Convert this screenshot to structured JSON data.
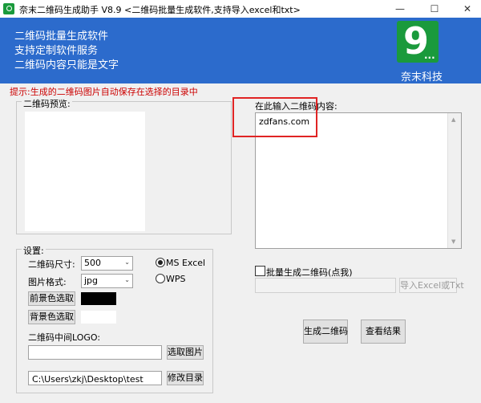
{
  "window": {
    "title": "奈末二维码生成助手 V8.9    <二维码批量生成软件,支持导入excel和txt>",
    "minimize": "—",
    "maximize": "☐",
    "close": "✕"
  },
  "banner": {
    "lines": [
      "二维码批量生成软件",
      "支持定制软件服务",
      "二维码内容只能是文字"
    ],
    "logo_text": "9",
    "logo_dots": "...",
    "company": "奈末科技",
    "bg_color": "#2c6bcc",
    "logo_color": "#1a9a3c"
  },
  "hint": "提示:生成的二维码图片自动保存在选择的目录中",
  "preview": {
    "label": "二维码预览:"
  },
  "input": {
    "label": "在此输入二维码内容:",
    "value": "zdfans.com",
    "scroll_up": "▲",
    "scroll_down": "▼"
  },
  "settings": {
    "title": "设置:",
    "size_label": "二维码尺寸:",
    "size_value": "500",
    "format_label": "图片格式:",
    "format_value": "jpg",
    "dropdown_arrow": "⌄",
    "radio_excel": "MS  Excel",
    "radio_wps": "WPS",
    "fg_button": "前景色选取",
    "bg_button": "背景色选取",
    "fg_color": "#000000",
    "bg_color": "#ffffff",
    "logo_label": "二维码中间LOGO:",
    "logo_path": "",
    "select_image": "选取图片",
    "output_path": "C:\\Users\\zkj\\Desktop\\test",
    "change_dir": "修改目录"
  },
  "batch": {
    "checkbox_label": "批量生成二维码(点我)",
    "path": "",
    "import_button": "导入Excel或Txt"
  },
  "actions": {
    "generate": "生成二维码",
    "view": "查看结果"
  }
}
